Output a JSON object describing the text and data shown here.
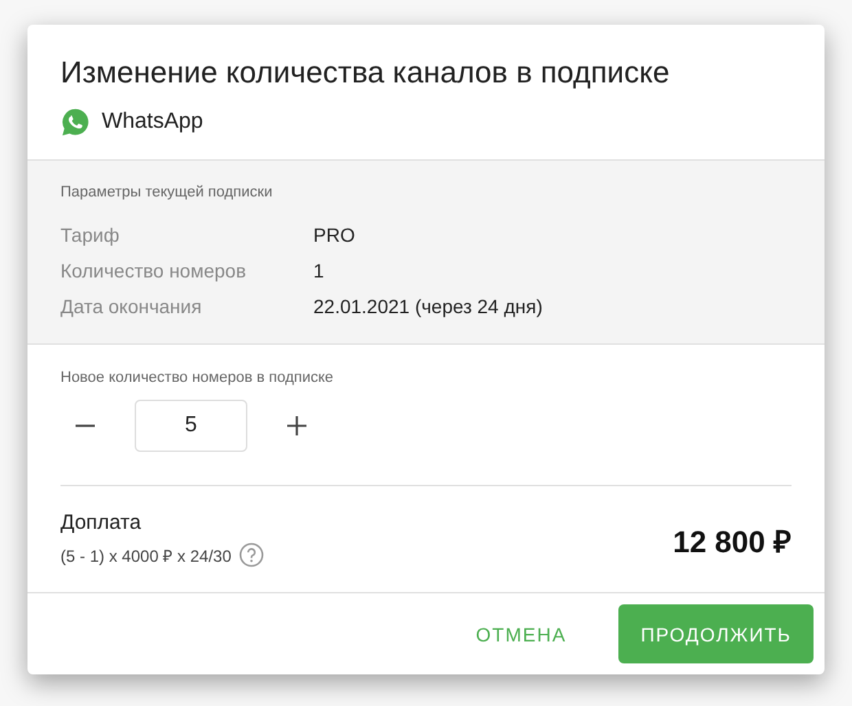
{
  "dialog": {
    "title": "Изменение количества каналов в подписке",
    "channel": "WhatsApp"
  },
  "current": {
    "heading": "Параметры текущей подписки",
    "rows": [
      {
        "label": "Тариф",
        "value": "PRO"
      },
      {
        "label": "Количество номеров",
        "value": "1"
      },
      {
        "label": "Дата окончания",
        "value": "22.01.2021 (через 24 дня)"
      }
    ]
  },
  "quantity": {
    "label": "Новое количество номеров в подписке",
    "value": "5"
  },
  "payment": {
    "label": "Доплата",
    "formula": "(5 - 1) x 4000 ₽ x 24/30",
    "amount": "12 800 ₽"
  },
  "buttons": [
    {
      "label": "ОТМЕНА",
      "kind": "text"
    },
    {
      "label": "ПРОДОЛЖИТЬ",
      "kind": "primary"
    }
  ]
}
